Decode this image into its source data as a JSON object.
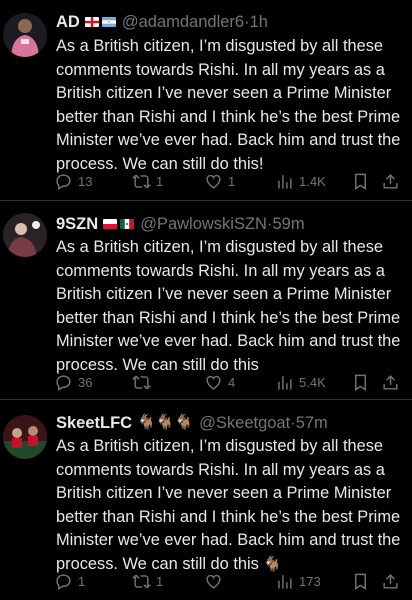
{
  "tweets": [
    {
      "name": "AD",
      "flags": [
        "england",
        "argentina"
      ],
      "handle": "@adamdandler6",
      "time": "1h",
      "text": "As a British citizen, I’m disgusted by all these comments towards Rishi. In all my years as a British citizen I’ve never seen a Prime Minister better than Rishi and I think he’s the best Prime Minister we’ve ever had. Back him and trust the process. We can still do this!",
      "replies": "13",
      "reposts": "1",
      "likes": "1",
      "views": "1.4K"
    },
    {
      "name": "9SZN",
      "flags": [
        "poland",
        "mexico"
      ],
      "handle": "@PawlowskiSZN",
      "time": "59m",
      "text": "As a British citizen, I’m disgusted by all these comments towards Rishi. In all my years as a British citizen I’ve never seen a Prime Minister better than Rishi and I think he’s the best Prime Minister we’ve ever had. Back him and trust the process. We can still do this",
      "replies": "36",
      "reposts": "",
      "likes": "4",
      "views": "5.4K"
    },
    {
      "name": "SkeetLFC",
      "name_emoji": "🐐🐐🐐",
      "handle": "@Skeetgoat",
      "time": "57m",
      "text": "As a British citizen, I’m disgusted by all these comments towards Rishi. In all my years as a British citizen I’ve never seen a Prime Minister better than Rishi and I think he’s the best Prime Minister we’ve ever had. Back him and trust the process. We can still do this",
      "text_emoji": "🐐",
      "replies": "1",
      "reposts": "1",
      "likes": "",
      "views": "173"
    }
  ],
  "separator": "·",
  "icons": [
    "reply-icon",
    "repost-icon",
    "like-icon",
    "views-icon",
    "bookmark-icon",
    "share-icon"
  ],
  "colors": {
    "background": "#000000",
    "text": "#e7e9ea",
    "muted": "#71767b",
    "divider": "#2f3336"
  }
}
